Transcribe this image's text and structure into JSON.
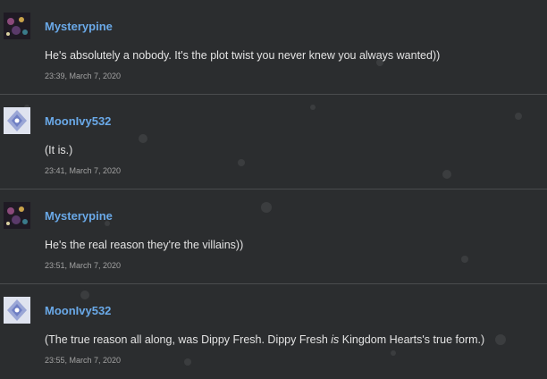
{
  "comments": [
    {
      "author": "Mysterypine",
      "avatar": "galaxy-avatar-icon",
      "text": "He's absolutely a nobody. It's the plot twist you never knew you always wanted))",
      "timestamp": "23:39, March 7, 2020"
    },
    {
      "author": "MoonIvy532",
      "avatar": "crystal-avatar-icon",
      "text": "(It is.)",
      "timestamp": "23:41, March 7, 2020"
    },
    {
      "author": "Mysterypine",
      "avatar": "galaxy-avatar-icon",
      "text": "He's the real reason they're the villains))",
      "timestamp": "23:51, March 7, 2020"
    },
    {
      "author": "MoonIvy532",
      "avatar": "crystal-avatar-icon",
      "text_before": "(The true reason all along, was Dippy Fresh. Dippy Fresh ",
      "text_italic": "is",
      "text_after": " Kingdom Hearts's true form.)",
      "timestamp": "23:55, March 7, 2020"
    }
  ],
  "colors": {
    "background": "#2b2d2f",
    "author": "#6aa9e8",
    "text": "#e3e3e3",
    "timestamp": "#a2a2a2",
    "divider": "#4a4c4e"
  }
}
